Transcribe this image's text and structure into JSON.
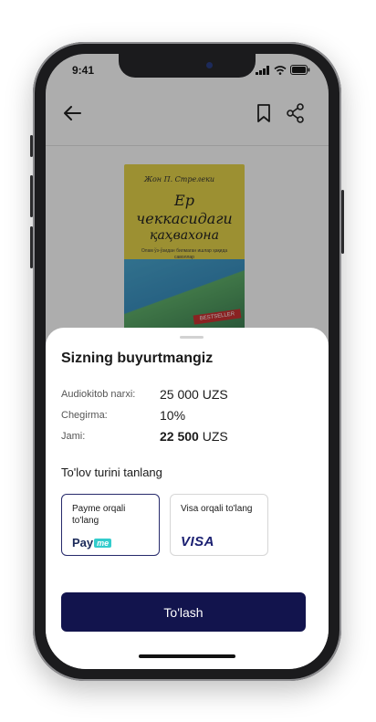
{
  "status_bar": {
    "time": "9:41"
  },
  "book": {
    "author": "Жон П. Стрелеки",
    "title_lines": [
      "Ер",
      "чеккасидаги",
      "қаҳвахона"
    ],
    "subtitle": "Олам ўз-ўзидан билмаган ишлар ҳақида саволлар",
    "badge": "BESTSELLER"
  },
  "sheet": {
    "title": "Sizning buyurtmangiz",
    "rows": [
      {
        "label": "Audiokitob narxi:",
        "value": "25 000 UZS"
      },
      {
        "label": "Chegirma:",
        "value": "10%"
      },
      {
        "label": "Jami:",
        "value_bold": "22 500",
        "value_unit": "UZS"
      }
    ],
    "payment_title": "To'lov turini tanlang",
    "methods": [
      {
        "label": "Payme orqali to'lang",
        "logo": "Payme",
        "logo_accent": "me",
        "selected": true
      },
      {
        "label": "Visa orqali to'lang",
        "logo": "VISA",
        "selected": false
      }
    ],
    "pay_button": "To'lash"
  },
  "colors": {
    "primary": "#12144d",
    "visa_blue": "#1a1f71",
    "payme_cyan": "#33cccc",
    "cover_yellow": "#e6d44a"
  }
}
